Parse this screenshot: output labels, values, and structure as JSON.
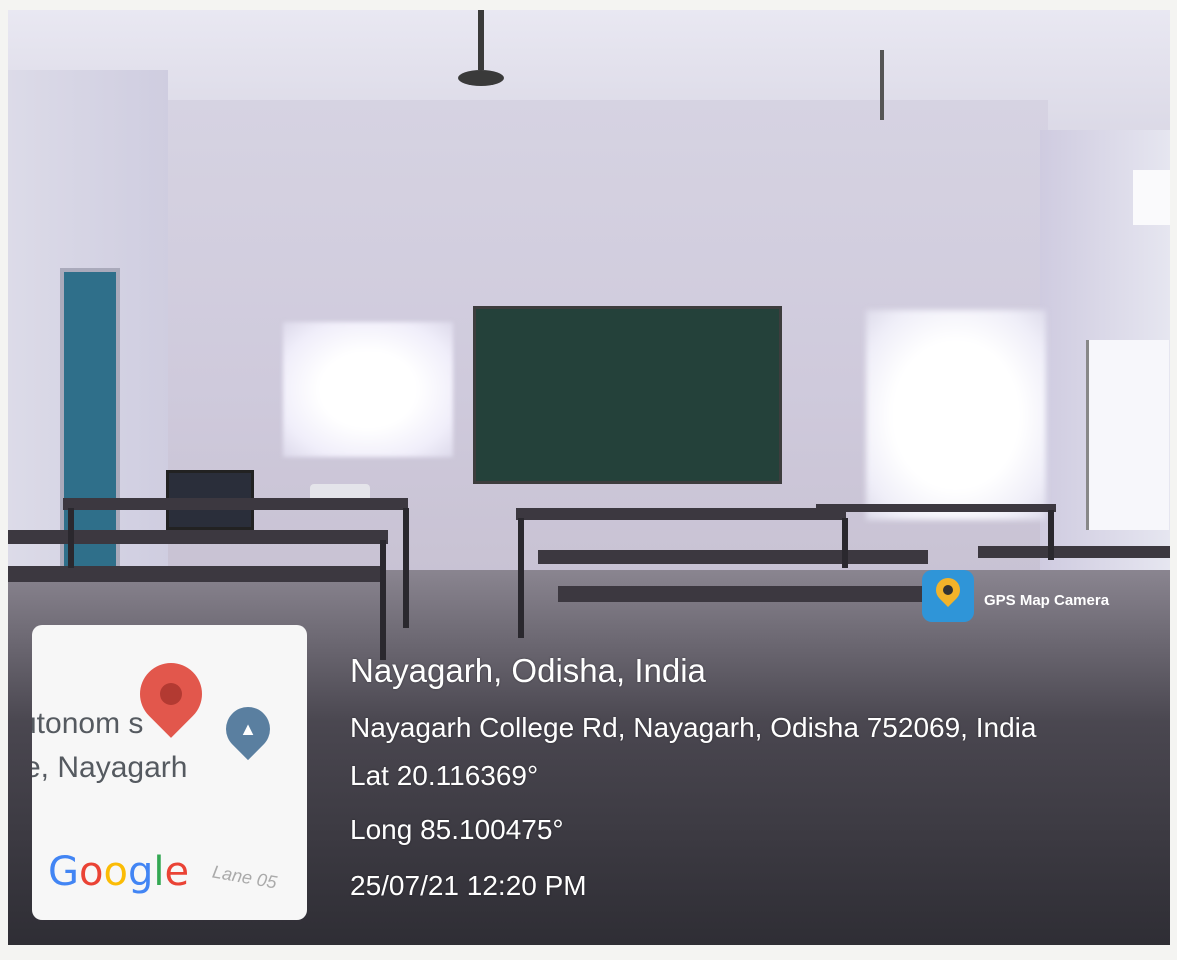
{
  "location": {
    "city_line": "Nayagarh, Odisha, India",
    "address": "Nayagarh College Rd, Nayagarh, Odisha 752069, India",
    "latitude": "Lat 20.116369°",
    "longitude": "Long 85.100475°",
    "datetime": "25/07/21 12:20 PM"
  },
  "badge": {
    "label": "GPS Map Camera",
    "icon": "location-pin-icon"
  },
  "map": {
    "place_line_1": "utonom  s",
    "place_line_2": "e, Nayagarh",
    "road_label": "Lane 05",
    "logo_letters": [
      "G",
      "o",
      "o",
      "g",
      "l",
      "e"
    ],
    "logo_colors": [
      "#4285F4",
      "#EA4335",
      "#FBBC05",
      "#4285F4",
      "#34A853",
      "#EA4335"
    ],
    "pin_color": "#e2574c",
    "school_pin_icon": "graduation-cap-icon"
  }
}
